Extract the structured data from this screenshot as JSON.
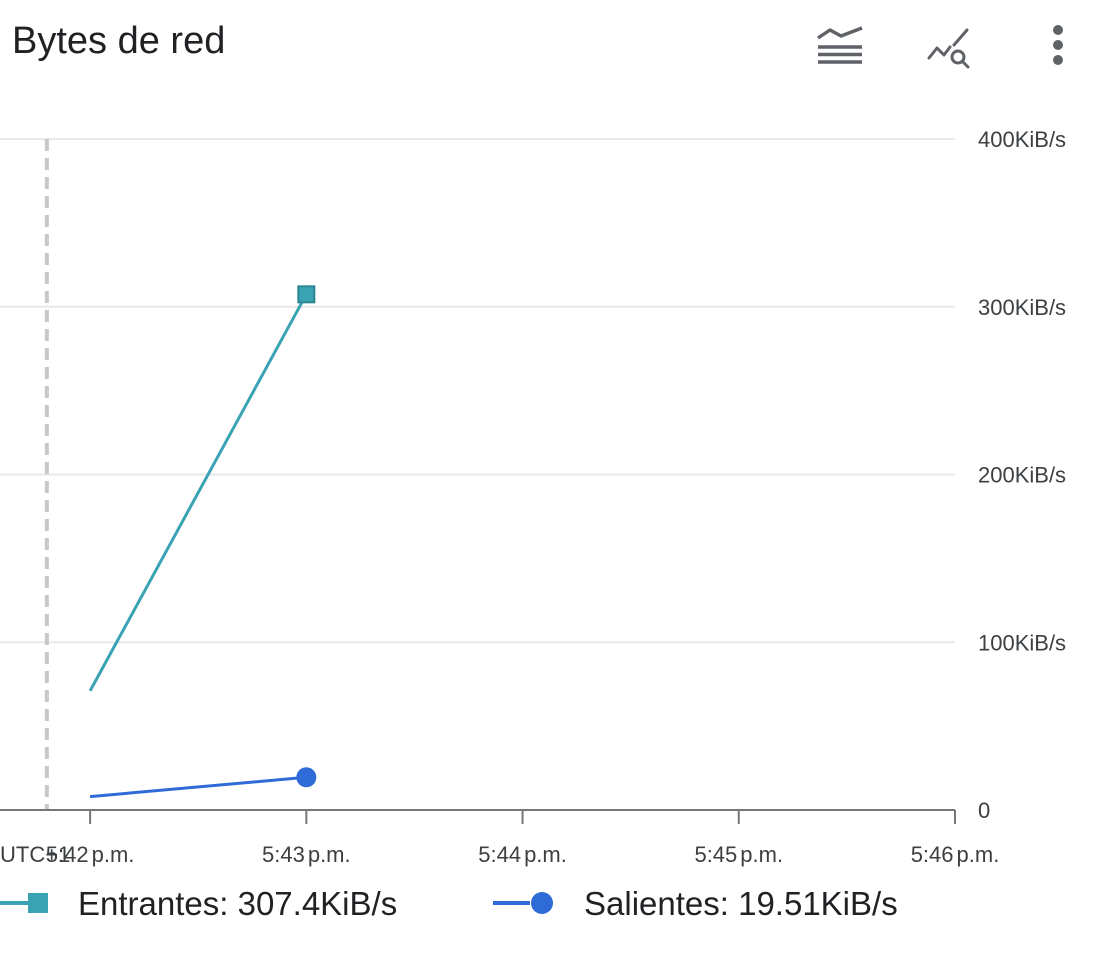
{
  "header": {
    "title": "Bytes de red",
    "icons": [
      "legend-toggle-icon",
      "explore-chart-icon",
      "more-vert-icon"
    ]
  },
  "colors": {
    "incoming": "#3aa3b3",
    "outgoing": "#2f6bd6",
    "grid": "#e8e8e8",
    "axis": "#777777",
    "now_marker": "#c8c8c8",
    "icon": "#5f6368"
  },
  "chart_data": {
    "type": "line",
    "title": "Bytes de red",
    "timezone_label": "UTC+1",
    "x_ticks": [
      {
        "time": "5:42",
        "suffix": "p.m."
      },
      {
        "time": "5:43",
        "suffix": "p.m."
      },
      {
        "time": "5:44",
        "suffix": "p.m."
      },
      {
        "time": "5:45",
        "suffix": "p.m."
      },
      {
        "time": "5:46",
        "suffix": "p.m."
      }
    ],
    "x_range": [
      "5:41:35 p.m.",
      "5:46:00 p.m."
    ],
    "now_marker": "5:41:48 p.m.",
    "y_ticks": [
      "0",
      "100KiB/s",
      "200KiB/s",
      "300KiB/s",
      "400KiB/s"
    ],
    "ylim": [
      0,
      400
    ],
    "y_unit": "KiB/s",
    "grid": true,
    "legend_position": "bottom",
    "series": [
      {
        "name": "Entrantes",
        "legend_value": "307.4KiB/s",
        "marker": "square",
        "points": [
          {
            "x": "5:42 p.m.",
            "y": 71
          },
          {
            "x": "5:43 p.m.",
            "y": 307.4
          }
        ]
      },
      {
        "name": "Salientes",
        "legend_value": "19.51KiB/s",
        "marker": "circle",
        "points": [
          {
            "x": "5:42 p.m.",
            "y": 8
          },
          {
            "x": "5:43 p.m.",
            "y": 19.51
          }
        ]
      }
    ]
  }
}
